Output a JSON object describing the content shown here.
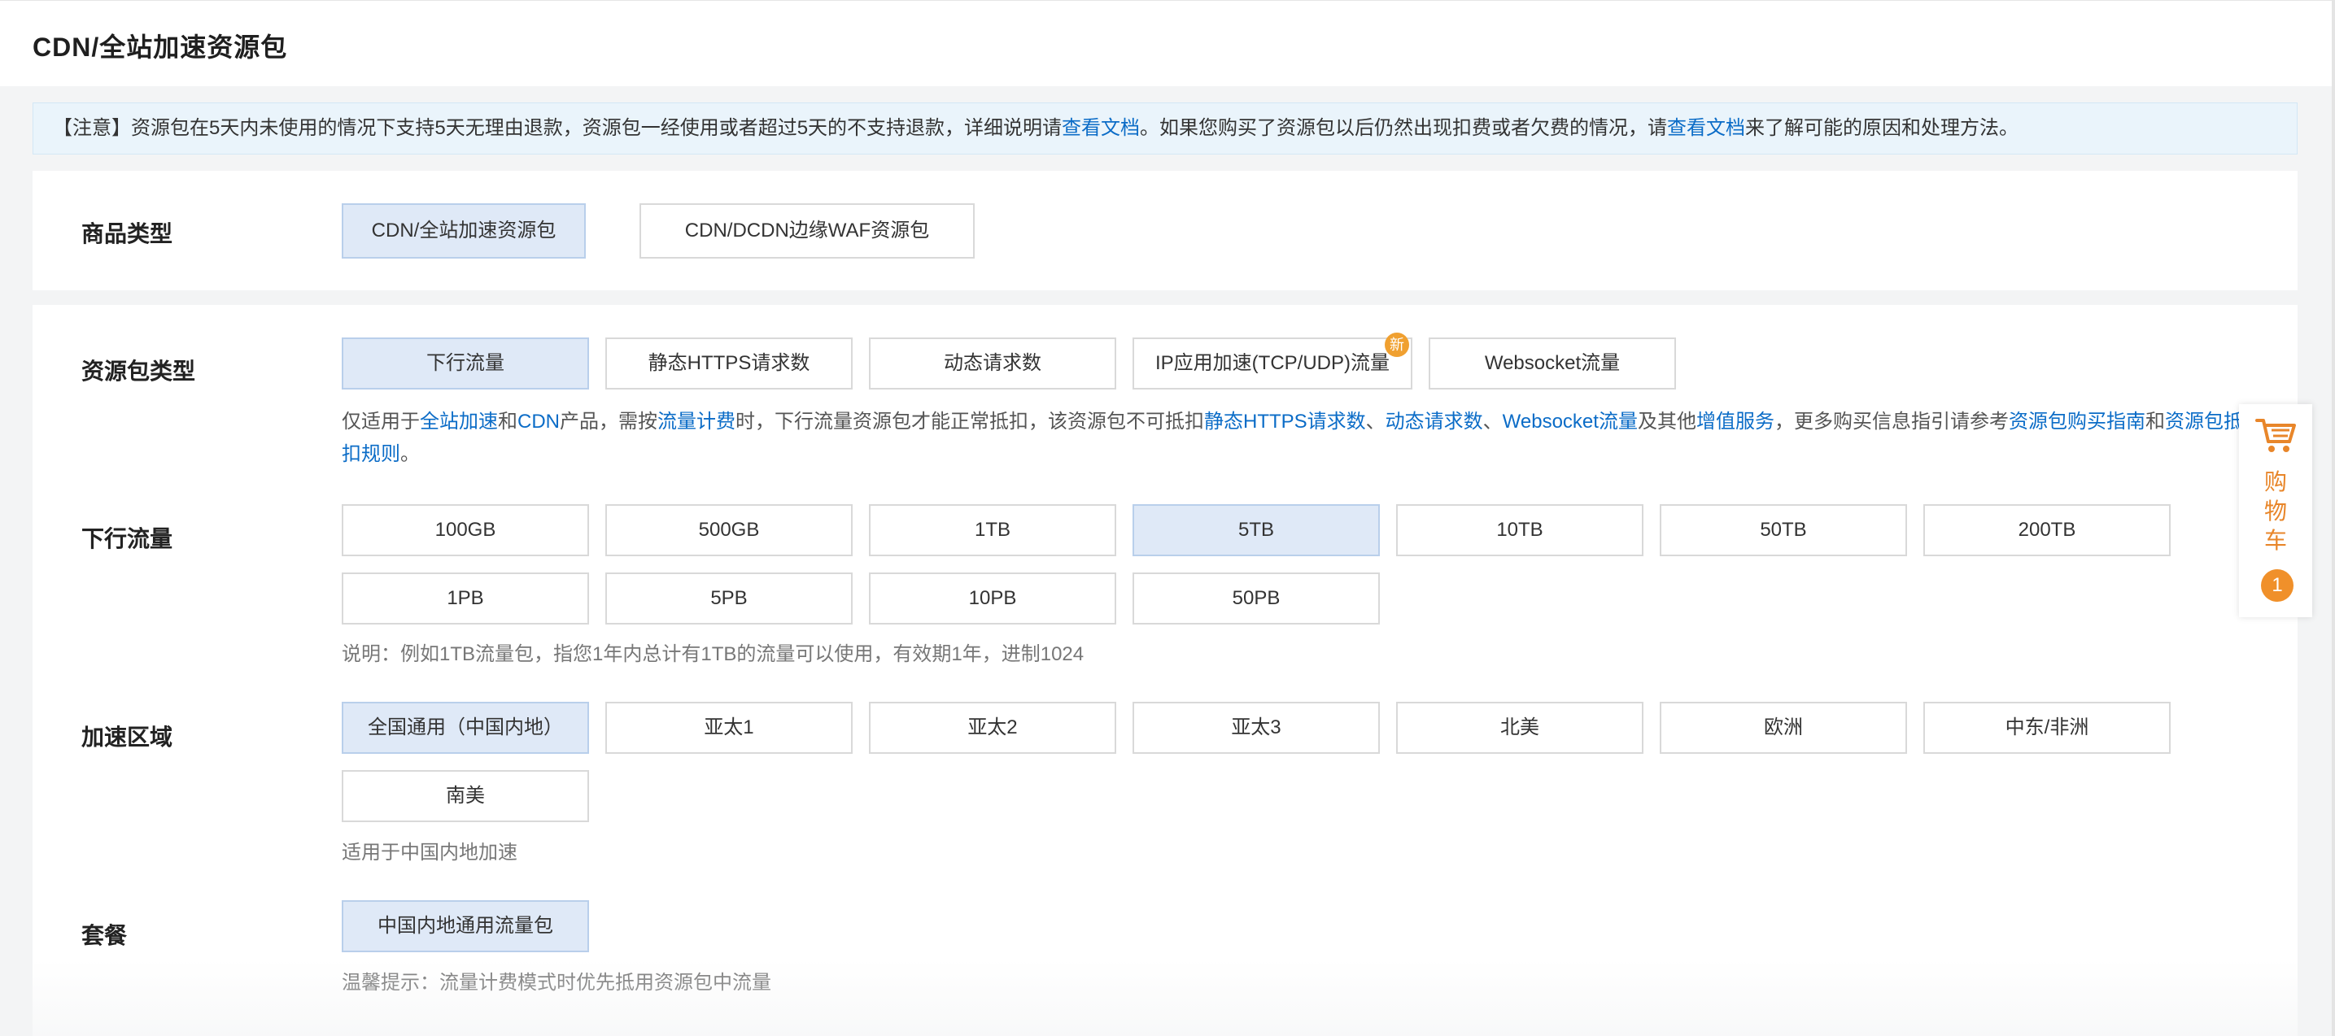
{
  "page": {
    "title": "CDN/全站加速资源包"
  },
  "notice": {
    "part1": "【注意】资源包在5天内未使用的情况下支持5天无理由退款，资源包一经使用或者超过5天的不支持退款，详细说明请",
    "link1": "查看文档",
    "part2": "。如果您购买了资源包以后仍然出现扣费或者欠费的情况，请",
    "link2": "查看文档",
    "part3": "来了解可能的原因和处理方法。"
  },
  "product_type": {
    "label": "商品类型",
    "options": [
      "CDN/全站加速资源包",
      "CDN/DCDN边缘WAF资源包"
    ],
    "selected": "CDN/全站加速资源包"
  },
  "package_type": {
    "label": "资源包类型",
    "options": [
      "下行流量",
      "静态HTTPS请求数",
      "动态请求数",
      "IP应用加速(TCP/UDP)流量",
      "Websocket流量"
    ],
    "selected": "下行流量",
    "new_badge": "新",
    "desc": {
      "t1": "仅适用于",
      "l1": "全站加速",
      "t2": "和",
      "l2": "CDN",
      "t3": "产品，需按",
      "l3": "流量计费",
      "t4": "时，下行流量资源包才能正常抵扣，该资源包不可抵扣",
      "l4": "静态HTTPS请求数",
      "t5": "、",
      "l5": "动态请求数",
      "t6": "、",
      "l6": "Websocket流量",
      "t7": "及其他",
      "l7": "增值服务",
      "t8": "，更多购买信息指引请参考",
      "l8": "资源包购买指南",
      "t9": "和",
      "l9a": "资源包抵",
      "l9b": "扣规则",
      "t10": "。"
    }
  },
  "traffic": {
    "label": "下行流量",
    "options": [
      "100GB",
      "500GB",
      "1TB",
      "5TB",
      "10TB",
      "50TB",
      "200TB",
      "1PB",
      "5PB",
      "10PB",
      "50PB"
    ],
    "selected": "5TB",
    "note": "说明：例如1TB流量包，指您1年内总计有1TB的流量可以使用，有效期1年，进制1024"
  },
  "region": {
    "label": "加速区域",
    "options": [
      "全国通用（中国内地）",
      "亚太1",
      "亚太2",
      "亚太3",
      "北美",
      "欧洲",
      "中东/非洲",
      "南美"
    ],
    "selected": "全国通用（中国内地）",
    "note": "适用于中国内地加速"
  },
  "plan": {
    "label": "套餐",
    "options": [
      "中国内地通用流量包"
    ],
    "selected": "中国内地通用流量包",
    "note": "温馨提示：流量计费模式时优先抵用资源包中流量"
  },
  "cart": {
    "label_1": "购",
    "label_2": "物",
    "label_3": "车",
    "count": "1",
    "accent": "#f0902a"
  },
  "colors": {
    "link": "#0b6cc7",
    "selected_bg": "#dfe9f7"
  }
}
